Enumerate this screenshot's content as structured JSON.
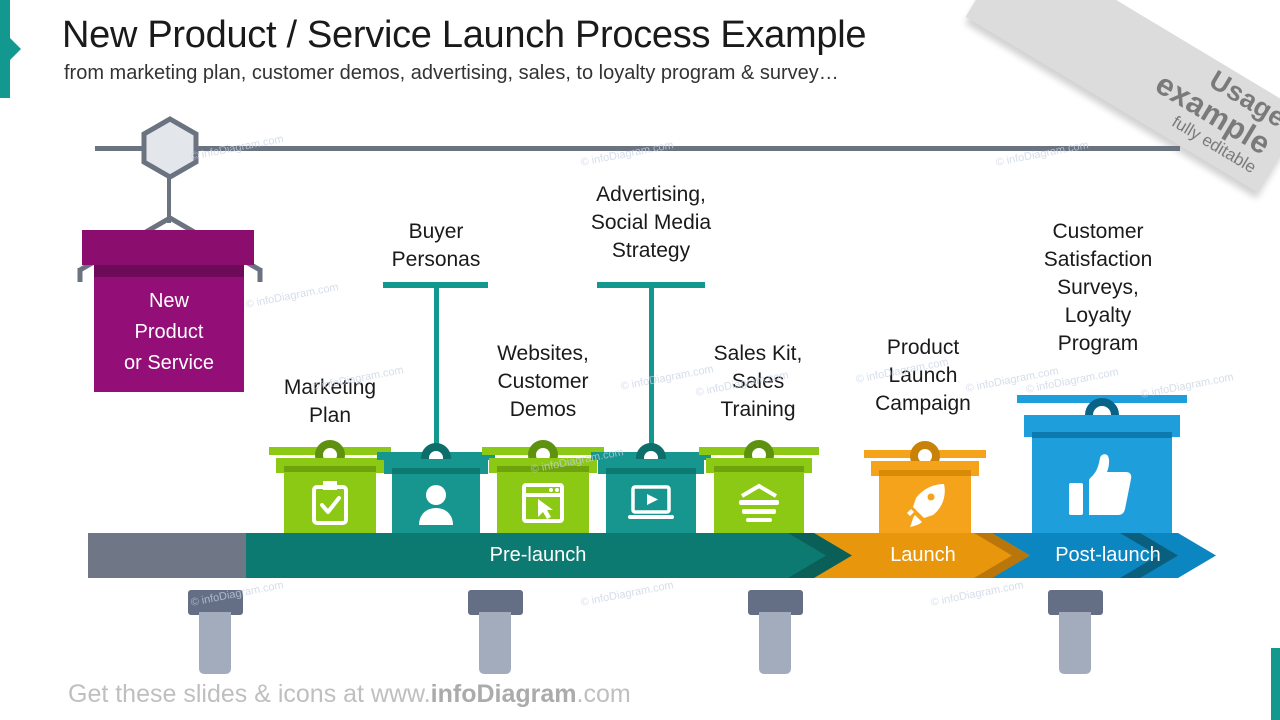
{
  "header": {
    "title": "New Product / Service Launch Process Example",
    "subtitle": "from marketing plan, customer demos, advertising, sales, to loyalty program & survey…"
  },
  "ribbon": {
    "line1": "Usage",
    "line2": "example",
    "line3": "fully editable"
  },
  "source": {
    "label": "New\nProduct\nor Service",
    "line1": "New",
    "line2": "Product",
    "line3": "or Service",
    "color": "#930E77"
  },
  "phases": [
    {
      "label": "Pre-launch",
      "color": "#0D7A72"
    },
    {
      "label": "Launch",
      "color": "#E8960C"
    },
    {
      "label": "Post-launch",
      "color": "#0C86C0"
    }
  ],
  "boxes": [
    {
      "label": "Marketing\nPlan",
      "lines": [
        "Marketing",
        "Plan"
      ],
      "icon": "clipboard-check-icon",
      "color": "#8CC914",
      "hanging": false
    },
    {
      "label": "Buyer\nPersonas",
      "lines": [
        "Buyer",
        "Personas"
      ],
      "icon": "person-icon",
      "color": "#17968F",
      "hanging": true
    },
    {
      "label": "Websites,\nCustomer\nDemos",
      "lines": [
        "Websites,",
        "Customer",
        "Demos"
      ],
      "icon": "browser-cursor-icon",
      "color": "#8CC914",
      "hanging": false
    },
    {
      "label": "Advertising,\nSocial Media\nStrategy",
      "lines": [
        "Advertising,",
        "Social Media",
        "Strategy"
      ],
      "icon": "laptop-play-icon",
      "color": "#17968F",
      "hanging": true
    },
    {
      "label": "Sales Kit,\nSales\nTraining",
      "lines": [
        "Sales Kit,",
        "Sales",
        "Training"
      ],
      "icon": "stacked-layers-icon",
      "color": "#8CC914",
      "hanging": false
    },
    {
      "label": "Product\nLaunch\nCampaign",
      "lines": [
        "Product",
        "Launch",
        "Campaign"
      ],
      "icon": "rocket-icon",
      "color": "#F5A31A",
      "hanging": false
    },
    {
      "label": "Customer\nSatisfaction\nSurveys,\nLoyalty\nProgram",
      "lines": [
        "Customer",
        "Satisfaction",
        "Surveys,",
        "Loyalty",
        "Program"
      ],
      "icon": "thumbs-up-icon",
      "color": "#1E9FDC",
      "hanging": false
    }
  ],
  "footer": {
    "prefix": "Get these slides & icons at www.",
    "brand": "infoDiagram",
    "suffix": ".com"
  },
  "watermark": {
    "text": "© infoDiagram.com"
  },
  "colors": {
    "green": "#8CC914",
    "teal": "#17968F",
    "teal_dark": "#0D7A72",
    "orange": "#F5A31A",
    "orange_dark": "#E8960C",
    "blue": "#1E9FDC",
    "blue_dark": "#0C86C0",
    "purple": "#930E77",
    "gray": "#6B7280",
    "gray_chevron": "#6F7686"
  }
}
